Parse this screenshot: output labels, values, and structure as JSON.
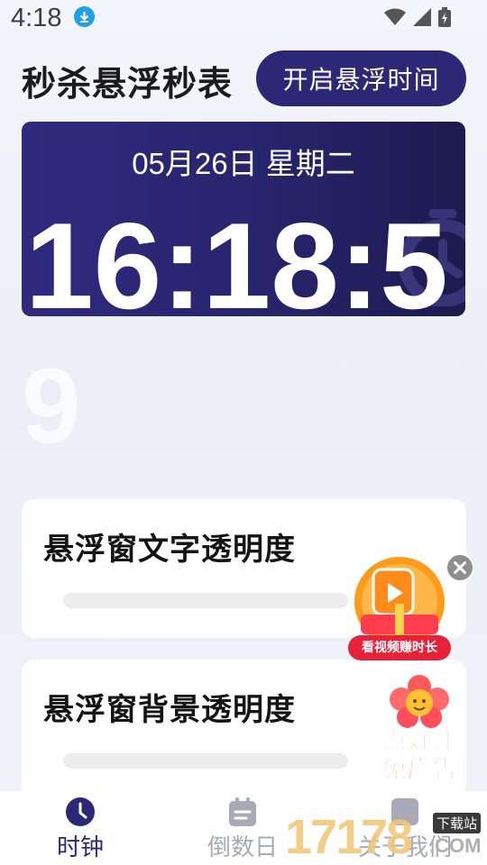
{
  "status_bar": {
    "time": "4:18",
    "icons": [
      "download-icon",
      "wifi-icon",
      "cell-signal-icon",
      "battery-charging-icon"
    ]
  },
  "header": {
    "title": "秒杀悬浮秒表",
    "float_button_label": "开启悬浮时间"
  },
  "clock": {
    "date": "05月26日 星期二",
    "time_main": "16:18:5",
    "time_overflow": "9"
  },
  "settings": [
    {
      "title": "悬浮窗文字透明度",
      "value": 0
    },
    {
      "title": "悬浮窗背景透明度",
      "value": 0
    }
  ],
  "ads": {
    "video_label": "看视频赚时长",
    "review_lines": [
      "点好评",
      "免广告"
    ]
  },
  "bottom_nav": [
    {
      "label": "时钟",
      "icon": "clock-icon",
      "active": true
    },
    {
      "label": "倒数日",
      "icon": "calendar-icon",
      "active": false
    },
    {
      "label": "关于我们",
      "icon": "info-icon",
      "active": false
    }
  ],
  "watermark": {
    "number": "17178",
    "tag": "下载站",
    "domain": ".COM"
  },
  "colors": {
    "primary": "#2c2875",
    "card": "#28246c",
    "nav_active": "#2c2875",
    "nav_inactive": "#a9a9b8"
  }
}
